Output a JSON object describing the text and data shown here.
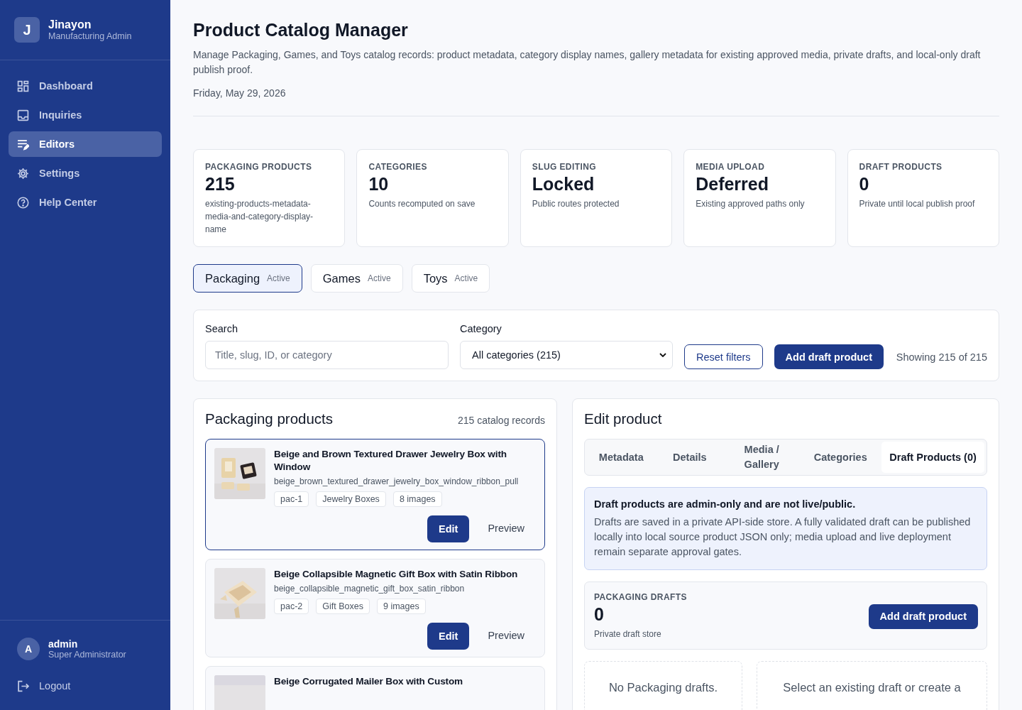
{
  "brand": {
    "initial": "J",
    "name": "Jinayon",
    "subtitle": "Manufacturing Admin"
  },
  "nav": [
    {
      "label": "Dashboard",
      "selected": false
    },
    {
      "label": "Inquiries",
      "selected": false
    },
    {
      "label": "Editors",
      "selected": true
    },
    {
      "label": "Settings",
      "selected": false
    },
    {
      "label": "Help Center",
      "selected": false
    }
  ],
  "user": {
    "initial": "A",
    "name": "admin",
    "role": "Super Administrator"
  },
  "logout": "Logout",
  "header": {
    "title": "Product Catalog Manager",
    "description": "Manage Packaging, Games, and Toys catalog records: product metadata, category display names, gallery metadata for existing approved media, private drafts, and local-only draft publish proof.",
    "date": "Friday, May 29, 2026"
  },
  "stats": [
    {
      "label": "PACKAGING PRODUCTS",
      "value": "215",
      "note": "existing-products-metadata-media-and-category-display-name"
    },
    {
      "label": "CATEGORIES",
      "value": "10",
      "note": "Counts recomputed on save"
    },
    {
      "label": "SLUG EDITING",
      "value": "Locked",
      "note": "Public routes protected"
    },
    {
      "label": "MEDIA UPLOAD",
      "value": "Deferred",
      "note": "Existing approved paths only"
    },
    {
      "label": "DRAFT PRODUCTS",
      "value": "0",
      "note": "Private until local publish proof"
    }
  ],
  "catalog_tabs": [
    {
      "label": "Packaging",
      "badge": "Active",
      "selected": true
    },
    {
      "label": "Games",
      "badge": "Active",
      "selected": false
    },
    {
      "label": "Toys",
      "badge": "Active",
      "selected": false
    }
  ],
  "filters": {
    "search_label": "Search",
    "search_placeholder": "Title, slug, ID, or category",
    "category_label": "Category",
    "category_value": "All categories (215)",
    "reset": "Reset filters",
    "add": "Add draft product",
    "showing": "Showing 215 of 215"
  },
  "products_panel": {
    "title": "Packaging products",
    "count": "215 catalog records",
    "products": [
      {
        "title": "Beige and Brown Textured Drawer Jewelry Box with Window",
        "slug": "beige_brown_textured_drawer_jewelry_box_window_ribbon_pull",
        "tags": [
          "pac-1",
          "Jewelry Boxes",
          "8 images"
        ],
        "edit": "Edit",
        "preview": "Preview",
        "selected": true
      },
      {
        "title": "Beige Collapsible Magnetic Gift Box with Satin Ribbon",
        "slug": "beige_collapsible_magnetic_gift_box_satin_ribbon",
        "tags": [
          "pac-2",
          "Gift Boxes",
          "9 images"
        ],
        "edit": "Edit",
        "preview": "Preview",
        "selected": false
      },
      {
        "title": "Beige Corrugated Mailer Box with Custom",
        "selected": false
      }
    ]
  },
  "editor": {
    "title": "Edit product",
    "tabs": [
      {
        "label": "Metadata",
        "selected": false
      },
      {
        "label": "Details",
        "selected": false
      },
      {
        "label": "Media / Gallery",
        "selected": false
      },
      {
        "label": "Categories",
        "selected": false
      },
      {
        "label": "Draft Products (0)",
        "selected": true
      }
    ],
    "notice": {
      "title": "Draft products are admin-only and are not live/public.",
      "body": "Drafts are saved in a private API-side store. A fully validated draft can be published locally into local source product JSON only; media upload and live deployment remain separate approval gates."
    },
    "drafts": {
      "label": "PACKAGING DRAFTS",
      "value": "0",
      "note": "Private draft store",
      "button": "Add draft product"
    },
    "empty": [
      "No Packaging drafts.",
      "Select an existing draft or create a"
    ]
  }
}
